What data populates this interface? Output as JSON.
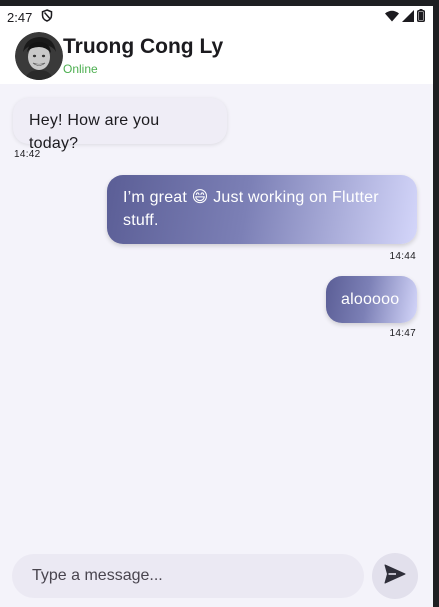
{
  "status_bar": {
    "time": "2:47",
    "icons": [
      "shield-icon",
      "wifi-icon",
      "signal-icon",
      "battery-icon"
    ]
  },
  "header": {
    "name": "Truong Cong Ly",
    "status": "Online",
    "status_color": "#4caf50"
  },
  "messages": [
    {
      "direction": "incoming",
      "text": "Hey! How are you today?",
      "time": "14:42"
    },
    {
      "direction": "outgoing",
      "text": "I’m great 😄 Just working on Flutter stuff.",
      "time": "14:44"
    },
    {
      "direction": "outgoing",
      "text": "alooooo",
      "time": "14:47"
    }
  ],
  "composer": {
    "placeholder": "Type a message...",
    "value": "",
    "send_icon": "send-icon"
  },
  "colors": {
    "background": "#f4f3fa",
    "incoming_bubble": "#efedf6",
    "outgoing_gradient_start": "#5b5e96",
    "outgoing_gradient_end": "#d4d6fa"
  }
}
